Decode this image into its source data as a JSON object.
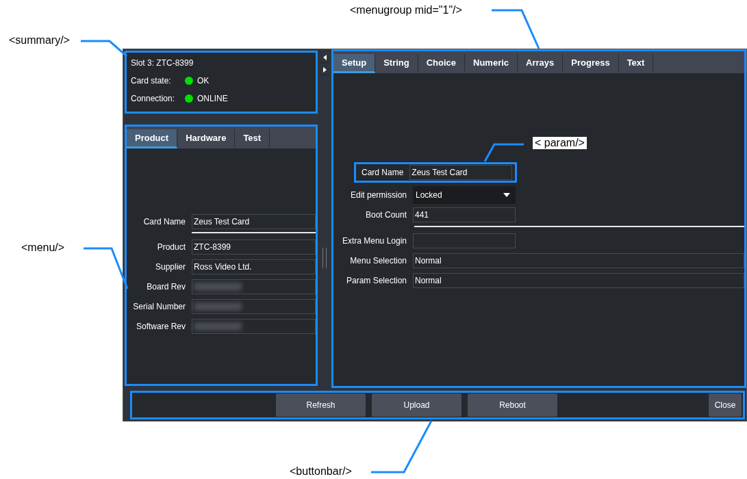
{
  "annotations": [
    {
      "kind": "summary",
      "label": "<summary/>"
    },
    {
      "kind": "menu",
      "label": "<menu/>"
    },
    {
      "kind": "menugroup",
      "label": "<menugroup mid=\"1\"/>"
    },
    {
      "kind": "param",
      "label": "< param/>"
    },
    {
      "kind": "buttonbar",
      "label": "<buttonbar/>"
    }
  ],
  "summary": {
    "title": "Slot 3: ZTC-8399",
    "status": [
      {
        "label": "Card state:",
        "value": "OK",
        "color": "#00e000"
      },
      {
        "label": "Connection:",
        "value": "ONLINE",
        "color": "#00e000"
      }
    ]
  },
  "menu": {
    "tabs": [
      {
        "label": "Product",
        "selected": true
      },
      {
        "label": "Hardware",
        "selected": false
      },
      {
        "label": "Test",
        "selected": false
      }
    ],
    "params": [
      {
        "kind": "text",
        "label": "Card Name",
        "value": "Zeus Test Card"
      },
      {
        "kind": "separator"
      },
      {
        "kind": "text",
        "label": "Product",
        "value": "ZTC-8399"
      },
      {
        "kind": "text",
        "label": "Supplier",
        "value": "Ross Video Ltd."
      },
      {
        "kind": "redacted",
        "label": "Board Rev"
      },
      {
        "kind": "redacted",
        "label": "Serial Number"
      },
      {
        "kind": "redacted",
        "label": "Software Rev"
      }
    ]
  },
  "menugroup": {
    "tabs": [
      {
        "label": "Setup",
        "selected": true
      },
      {
        "label": "String",
        "selected": false
      },
      {
        "label": "Choice",
        "selected": false
      },
      {
        "label": "Numeric",
        "selected": false
      },
      {
        "label": "Arrays",
        "selected": false
      },
      {
        "label": "Progress",
        "selected": false
      },
      {
        "label": "Text",
        "selected": false
      }
    ],
    "params": [
      {
        "kind": "text",
        "label": "Card Name",
        "value": "Zeus Test Card",
        "highlighted": true
      },
      {
        "kind": "dropdown",
        "label": "Edit permission",
        "value": "Locked"
      },
      {
        "kind": "text",
        "label": "Boot Count",
        "value": "441"
      },
      {
        "kind": "separator"
      },
      {
        "kind": "text",
        "label": "Extra Menu Login"
      },
      {
        "kind": "text",
        "label": "Menu Selection",
        "value": "Normal",
        "wide": true
      },
      {
        "kind": "text",
        "label": "Param Selection",
        "value": "Normal",
        "wide": true
      }
    ]
  },
  "buttons": [
    {
      "label": "Refresh"
    },
    {
      "label": "Upload"
    },
    {
      "label": "Reboot"
    }
  ],
  "close_button": "Close"
}
